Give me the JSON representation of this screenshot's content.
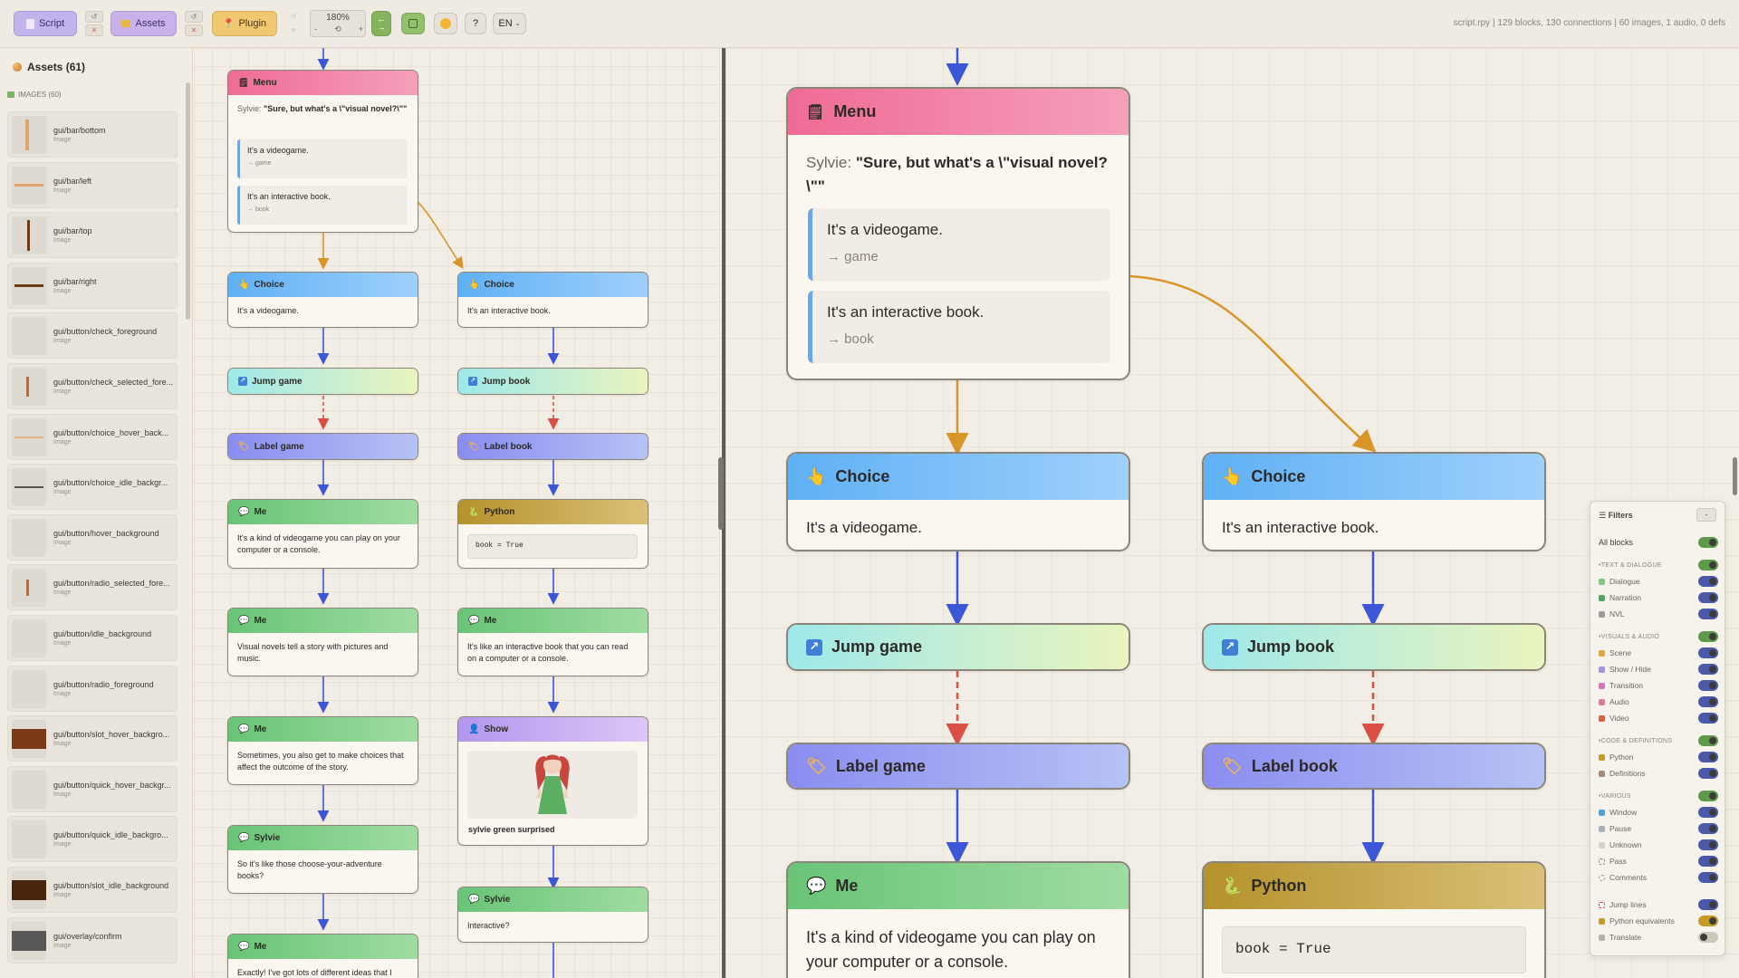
{
  "toolbar": {
    "script_label": "Script",
    "assets_label": "Assets",
    "plugin_label": "Plugin",
    "zoom_value": "180%",
    "zoom_minus": "-",
    "zoom_reset": "⟲",
    "zoom_plus": "+",
    "help_label": "?",
    "language": "EN",
    "stats": "script.rpy | 129 blocks, 130 connections | 60 images, 1 audio, 0 defs"
  },
  "sidebar": {
    "title": "Assets (61)",
    "section": "IMAGES (60)",
    "items": [
      {
        "name": "gui/bar/bottom",
        "type": "Image"
      },
      {
        "name": "gui/bar/left",
        "type": "Image"
      },
      {
        "name": "gui/bar/top",
        "type": "Image"
      },
      {
        "name": "gui/bar/right",
        "type": "Image"
      },
      {
        "name": "gui/button/check_foreground",
        "type": "Image"
      },
      {
        "name": "gui/button/check_selected_fore...",
        "type": "Image"
      },
      {
        "name": "gui/button/choice_hover_back...",
        "type": "Image"
      },
      {
        "name": "gui/button/choice_idle_backgr...",
        "type": "Image"
      },
      {
        "name": "gui/button/hover_background",
        "type": "Image"
      },
      {
        "name": "gui/button/radio_selected_fore...",
        "type": "Image"
      },
      {
        "name": "gui/button/idle_background",
        "type": "Image"
      },
      {
        "name": "gui/button/radio_foreground",
        "type": "Image"
      },
      {
        "name": "gui/button/slot_hover_backgro...",
        "type": "Image"
      },
      {
        "name": "gui/button/quick_hover_backgr...",
        "type": "Image"
      },
      {
        "name": "gui/button/quick_idle_backgro...",
        "type": "Image"
      },
      {
        "name": "gui/button/slot_idle_background",
        "type": "Image"
      },
      {
        "name": "gui/overlay/confirm",
        "type": "Image"
      }
    ]
  },
  "graph": {
    "menu_title": "Menu",
    "menu_speaker": "Sylvie:",
    "menu_prompt": "\"Sure, but what's a \\\"visual novel?\\\"\"",
    "option1_text": "It's a videogame.",
    "option1_target": "→ game",
    "option2_text": "It's an interactive book.",
    "option2_target": "→ book",
    "choice_title": "Choice",
    "choice1_text": "It's a videogame.",
    "choice2_text": "It's an interactive book.",
    "jump_game": "Jump game",
    "jump_book": "Jump book",
    "label_game": "Label game",
    "label_book": "Label book",
    "me_title": "Me",
    "sylvie_title": "Sylvie",
    "python_title": "Python",
    "python_code": "book = True",
    "show_title": "Show",
    "show_image": "sylvie green surprised",
    "me1_text": "It's a kind of videogame you can play on your computer or a console.",
    "me2_text": "Visual novels tell a story with pictures and music.",
    "me3_text": "Sometimes, you also get to make choices that affect the outcome of the story.",
    "sylvie1_text": "So it's like those choose-your-adventure books?",
    "me4_text": "Exactly! I've got lots of different ideas that I",
    "me_b1_text": "It's like an interactive book that you can read on a computer or a console.",
    "sylvie_b_text": "Interactive?"
  },
  "filters": {
    "title": "Filters",
    "close": "-",
    "all_blocks": "All blocks",
    "cat_text": "TEXT & DIALOGUE",
    "dialogue": "Dialogue",
    "narration": "Narration",
    "nvl": "NVL",
    "cat_visual": "VISUALS & AUDIO",
    "scene": "Scene",
    "show_hide": "Show / Hide",
    "transition": "Transition",
    "audio": "Audio",
    "video": "Video",
    "cat_code": "CODE & DEFINITIONS",
    "python": "Python",
    "definitions": "Definitions",
    "cat_various": "VARIOUS",
    "window": "Window",
    "pause": "Pause",
    "unknown": "Unknown",
    "pass": "Pass",
    "comments": "Comments",
    "jump_lines": "Jump lines",
    "python_equivalents": "Python equivalents",
    "translate": "Translate"
  }
}
